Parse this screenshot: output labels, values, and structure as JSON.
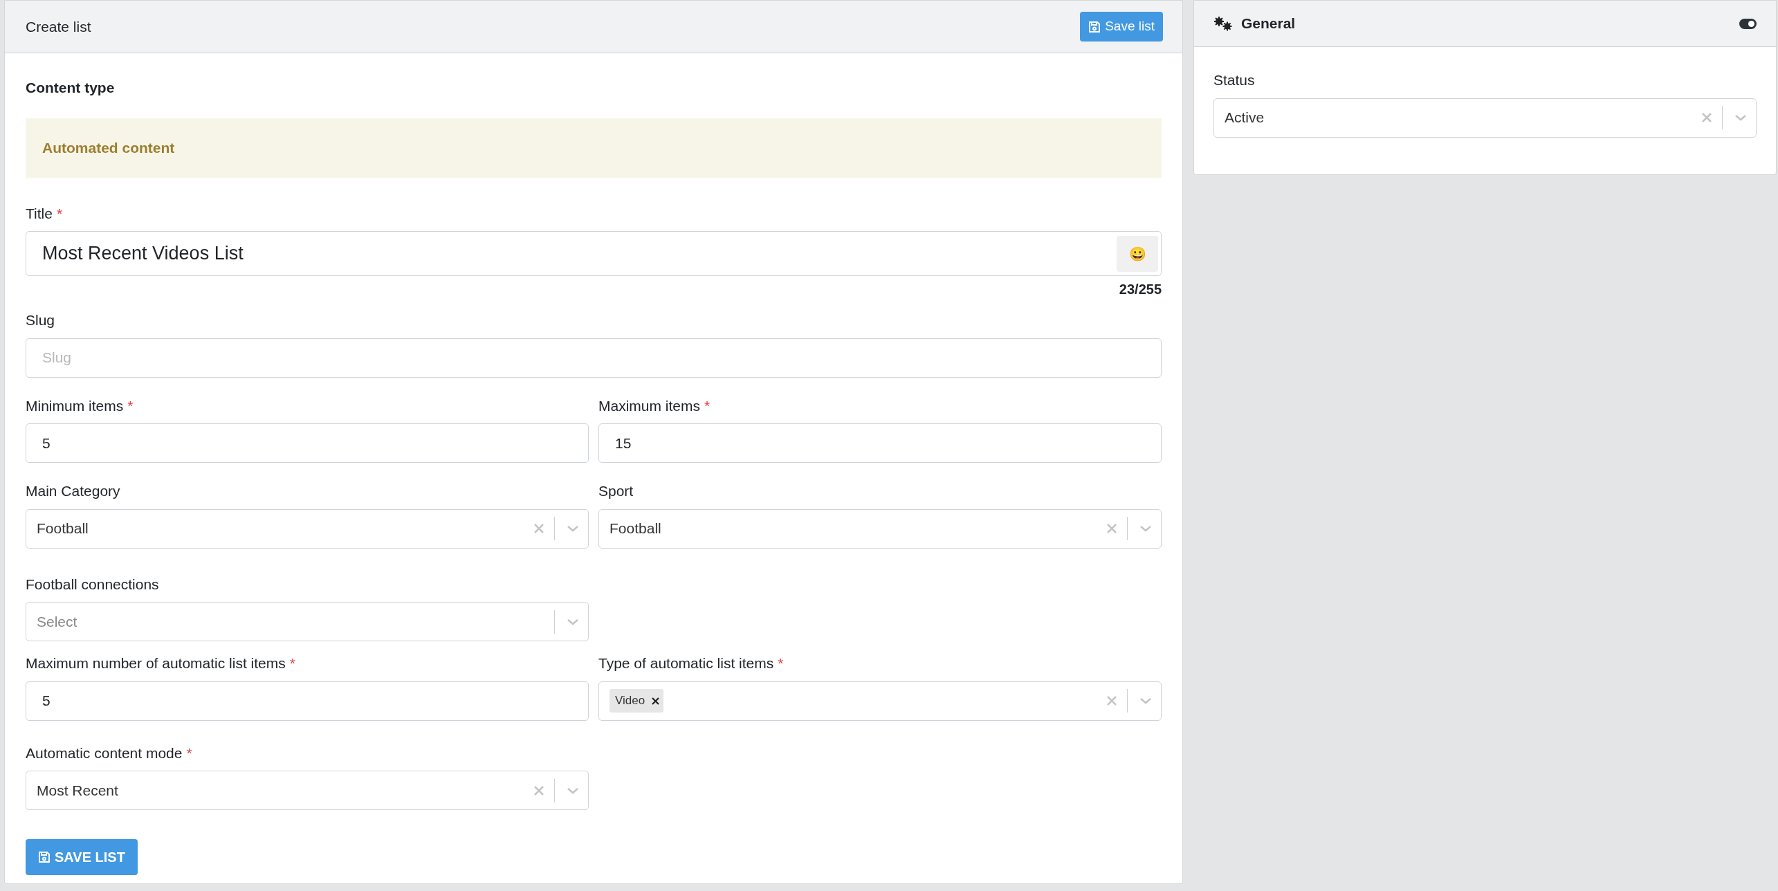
{
  "main": {
    "title": "Create list",
    "save_button": "Save list",
    "section_title": "Content type",
    "alert": "Automated content",
    "title_field": {
      "label": "Title",
      "marker": "*",
      "value": "Most Recent Videos List",
      "emoji": "😀",
      "counter": "23/255"
    },
    "rows": [
      {
        "fields": [
          {
            "kind": "text",
            "label": "Slug",
            "placeholder": "Slug"
          }
        ],
        "full": true
      },
      {
        "fields": [
          {
            "kind": "text",
            "label": "Minimum items",
            "marker": "*",
            "value": "5"
          },
          {
            "kind": "text",
            "label": "Maximum items",
            "marker": "*",
            "value": "15"
          }
        ],
        "full": false
      },
      {
        "fields": [
          {
            "kind": "select",
            "label": "Main Category",
            "value": "Football"
          },
          {
            "kind": "select",
            "label": "Sport",
            "value": "Football"
          }
        ],
        "full": false
      },
      {
        "fields": [
          {
            "kind": "select",
            "label": "Football connections",
            "placeholder": "Select"
          }
        ],
        "full": false
      },
      {
        "fields": [
          {
            "kind": "text",
            "label": "Maximum number of automatic list items",
            "marker": "*",
            "value": "5"
          },
          {
            "kind": "multiselect",
            "label": "Type of automatic list items",
            "marker": "*",
            "tags": [
              "Video"
            ]
          }
        ],
        "full": false
      },
      {
        "fields": [
          {
            "kind": "select",
            "label": "Automatic content mode",
            "marker": "*",
            "value": "Most Recent"
          }
        ],
        "full": false
      }
    ],
    "submit_button": "SAVE LIST"
  },
  "side": {
    "title": "General",
    "toggle": {
      "on": true
    },
    "status": {
      "label": "Status",
      "value": "Active"
    }
  }
}
